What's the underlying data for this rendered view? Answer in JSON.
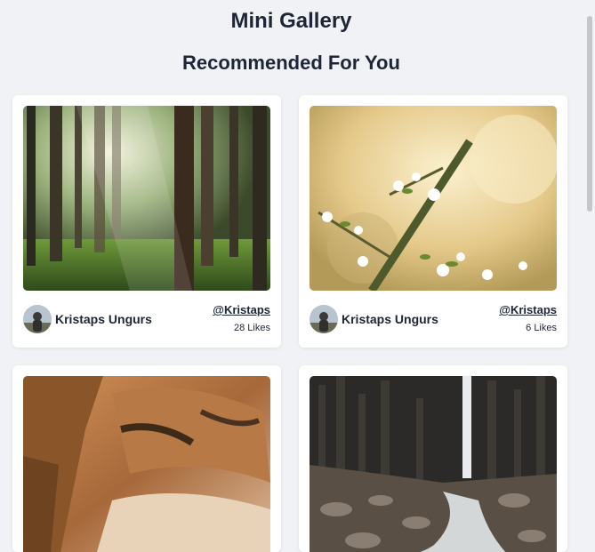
{
  "header": {
    "title": "Mini Gallery",
    "section_title": "Recommended For You"
  },
  "cards": [
    {
      "image": "forest-photo",
      "author": "Kristaps Ungurs",
      "handle": "@Kristaps",
      "likes": "28 Likes"
    },
    {
      "image": "blossom-photo",
      "author": "Kristaps Ungurs",
      "handle": "@Kristaps",
      "likes": "6 Likes"
    },
    {
      "image": "cave-photo"
    },
    {
      "image": "waterfall-photo"
    }
  ],
  "colors": {
    "background": "#f0f2f5",
    "card": "#ffffff",
    "text": "#1e2537"
  }
}
